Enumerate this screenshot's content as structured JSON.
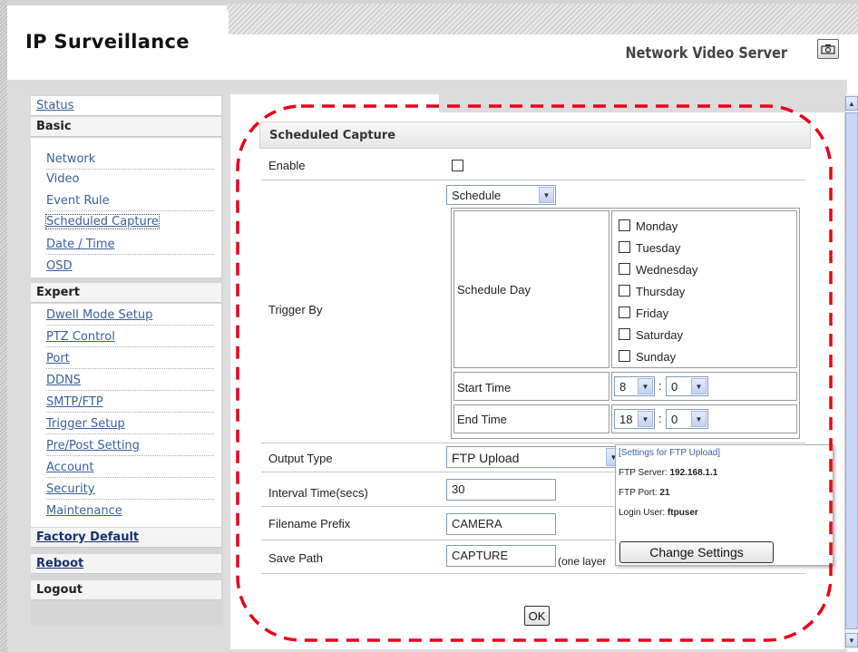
{
  "header": {
    "app_title": "IP Surveillance",
    "server_title": "Network Video Server",
    "snapshot_icon": "camera-icon"
  },
  "sidebar": {
    "status": "Status",
    "basic": "Basic",
    "basic_items": [
      "Network",
      "Video",
      "Event Rule",
      "Scheduled Capture",
      "Date / Time",
      "OSD"
    ],
    "expert": "Expert",
    "expert_items": [
      "Dwell Mode Setup",
      "PTZ Control",
      "Port",
      "DDNS",
      "SMTP/FTP",
      "Trigger Setup",
      "Pre/Post Setting",
      "Account",
      "Security",
      "Maintenance"
    ],
    "factory_default": "Factory Default",
    "reboot": "Reboot",
    "logout": "Logout",
    "selected": "Scheduled Capture"
  },
  "panel": {
    "title": "Scheduled Capture",
    "enable_label": "Enable",
    "enable_checked": false,
    "trigger_label": "Trigger By",
    "trigger_value": "Schedule",
    "schedule_day_label": "Schedule Day",
    "days": [
      "Monday",
      "Tuesday",
      "Wednesday",
      "Thursday",
      "Friday",
      "Saturday",
      "Sunday"
    ],
    "start_time_label": "Start Time",
    "start_hour": "8",
    "start_minute": "0",
    "end_time_label": "End Time",
    "end_hour": "18",
    "end_minute": "0",
    "time_separator": ":",
    "output_type_label": "Output Type",
    "output_type_value": "FTP Upload",
    "interval_label": "Interval Time(secs)",
    "interval_value": "30",
    "prefix_label": "Filename Prefix",
    "prefix_value": "CAMERA",
    "save_path_label": "Save Path",
    "save_path_value": "CAPTURE",
    "save_path_note": "(one layer"
  },
  "ftp_settings": {
    "title": "[Settings for FTP Upload]",
    "server_label": "FTP Server:",
    "server_value": "192.168.1.1",
    "port_label": "FTP Port:",
    "port_value": "21",
    "user_label": "Login User:",
    "user_value": "ftpuser",
    "change_button": "Change Settings"
  },
  "ok_button": "OK",
  "colors": {
    "link": "#3a5f9e",
    "annotation": "#e8001c",
    "scrollbar": "#c9d6f5"
  }
}
